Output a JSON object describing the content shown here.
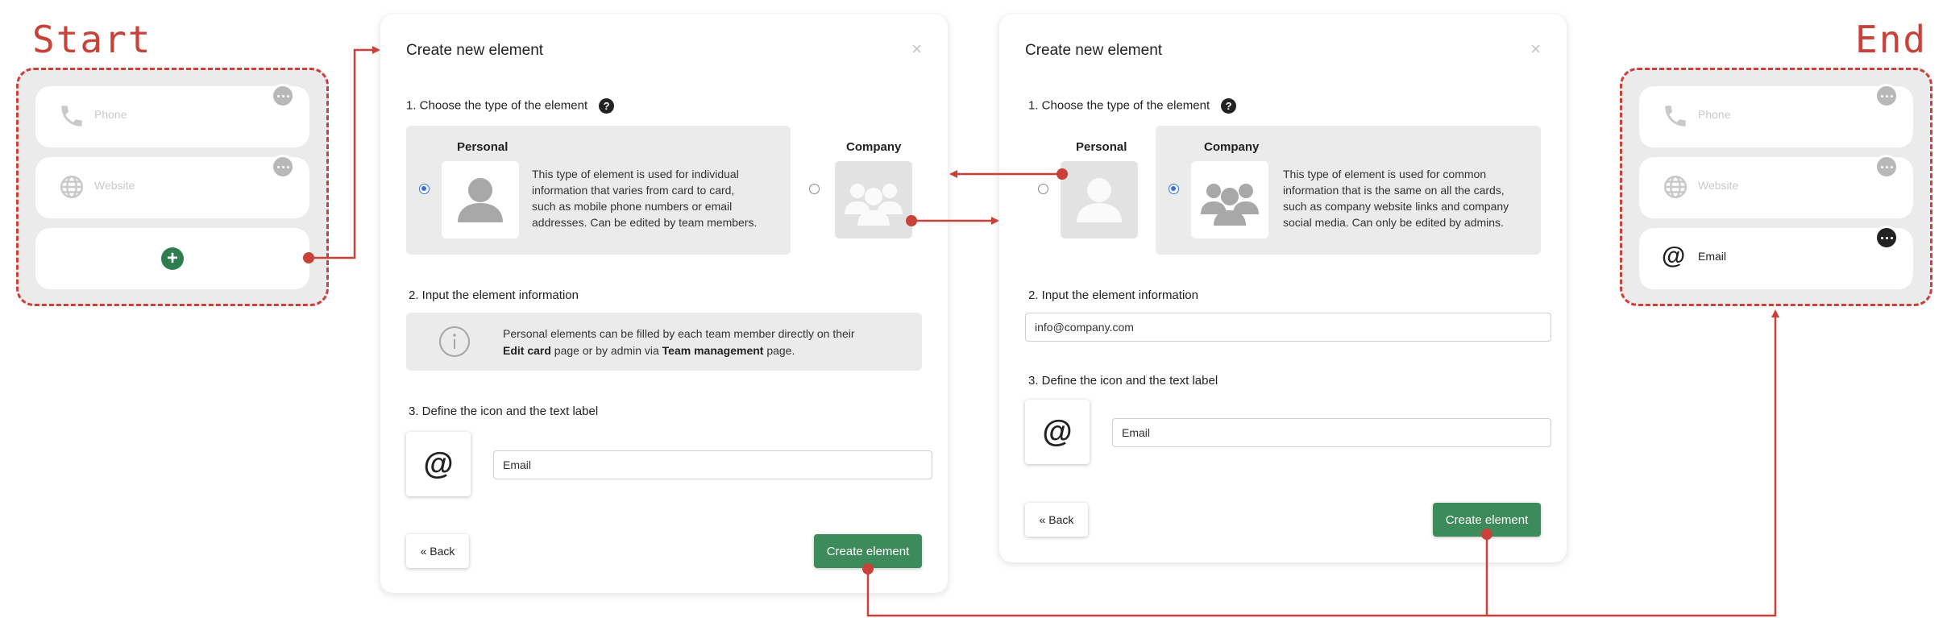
{
  "labels": {
    "start": "Start",
    "end": "End"
  },
  "start_group": {
    "cards": [
      {
        "label": "Phone",
        "icon": "phone-icon"
      },
      {
        "label": "Website",
        "icon": "globe-icon"
      }
    ],
    "add_icon": "+"
  },
  "end_group": {
    "cards": [
      {
        "label": "Phone",
        "icon": "phone-icon"
      },
      {
        "label": "Website",
        "icon": "globe-icon"
      },
      {
        "label": "Email",
        "icon": "at-icon"
      }
    ]
  },
  "modal_left": {
    "title": "Create new element",
    "close": "×",
    "step1": "1. Choose the type of the element",
    "help": "?",
    "personal_title": "Personal",
    "personal_desc": [
      "This type of element is used for individual",
      "information that varies from card to card,",
      "such as mobile phone numbers or email",
      "addresses. Can be edited by team members."
    ],
    "company_title": "Company",
    "step2": "2. Input the element information",
    "info_line1": "Personal elements can be filled by each team member directly on their",
    "info_bold1": "Edit card",
    "info_mid": " page or by admin via ",
    "info_bold2": "Team management",
    "info_end": " page.",
    "step3": "3. Define the icon and the text label",
    "icon_glyph": "@",
    "label_value": "Email",
    "back_label": "« Back",
    "create_label": "Create element"
  },
  "modal_right": {
    "title": "Create new element",
    "close": "×",
    "step1": "1. Choose the type of the element",
    "help": "?",
    "personal_title": "Personal",
    "company_title": "Company",
    "company_desc": [
      "This type of element is used for common",
      "information that is the same on all the cards,",
      "such as company website links and company",
      "social media. Can only be edited by admins."
    ],
    "step2": "2. Input the element information",
    "info_value": "info@company.com",
    "step3": "3. Define the icon and the text label",
    "icon_glyph": "@",
    "label_value": "Email",
    "back_label": "« Back",
    "create_label": "Create element"
  },
  "colors": {
    "accent": "#c8423a",
    "create_button": "#3d8a5a",
    "radio_selected": "#3a6fd8"
  }
}
